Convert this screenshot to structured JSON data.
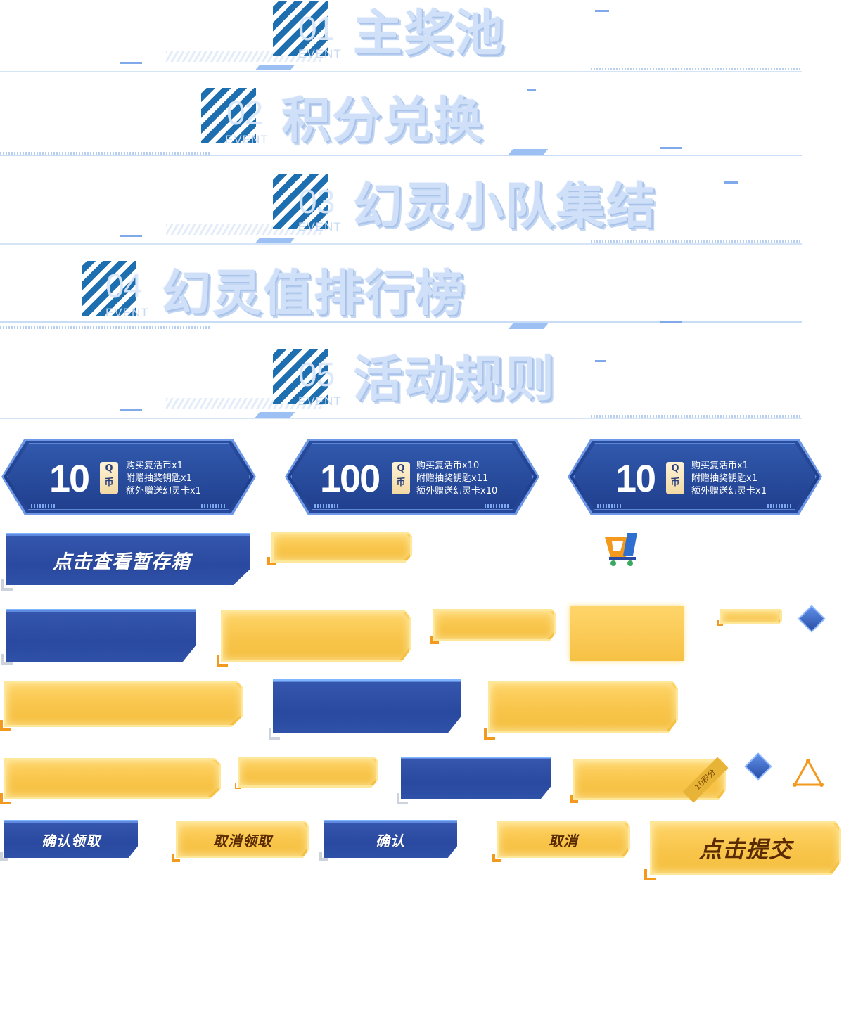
{
  "sections": [
    {
      "num": "01",
      "event": "EVENT",
      "title": "主奖池"
    },
    {
      "num": "02",
      "event": "EVENT",
      "title": "积分兑换"
    },
    {
      "num": "03",
      "event": "EVENT",
      "title": "幻灵小队集结"
    },
    {
      "num": "04",
      "event": "EVENT",
      "title": "幻灵值排行榜"
    },
    {
      "num": "05",
      "event": "EVENT",
      "title": "活动规则"
    }
  ],
  "cards": [
    {
      "amount": "10",
      "tag_top": "Q",
      "tag_bottom": "币",
      "line1": "购买复活币x1",
      "line2": "附赠抽奖钥匙x1",
      "line3": "额外赠送幻灵卡x1"
    },
    {
      "amount": "100",
      "tag_top": "Q",
      "tag_bottom": "币",
      "line1": "购买复活币x10",
      "line2": "附赠抽奖钥匙x11",
      "line3": "额外赠送幻灵卡x10"
    },
    {
      "amount": "10",
      "tag_top": "Q",
      "tag_bottom": "币",
      "line1": "购买复活币x1",
      "line2": "附赠抽奖钥匙x1",
      "line3": "额外赠送幻灵卡x1"
    }
  ],
  "buttons": {
    "view_storage": "点击查看暂存箱",
    "confirm_claim": "确认领取",
    "cancel_claim": "取消领取",
    "confirm": "确认",
    "cancel": "取消",
    "submit": "点击提交",
    "ribbon": "10积分"
  },
  "colors": {
    "blue": "#2a49a0",
    "gold": "#f8c54a",
    "accent_orange": "#f39a1e",
    "stripe": "#1e6fb0"
  }
}
